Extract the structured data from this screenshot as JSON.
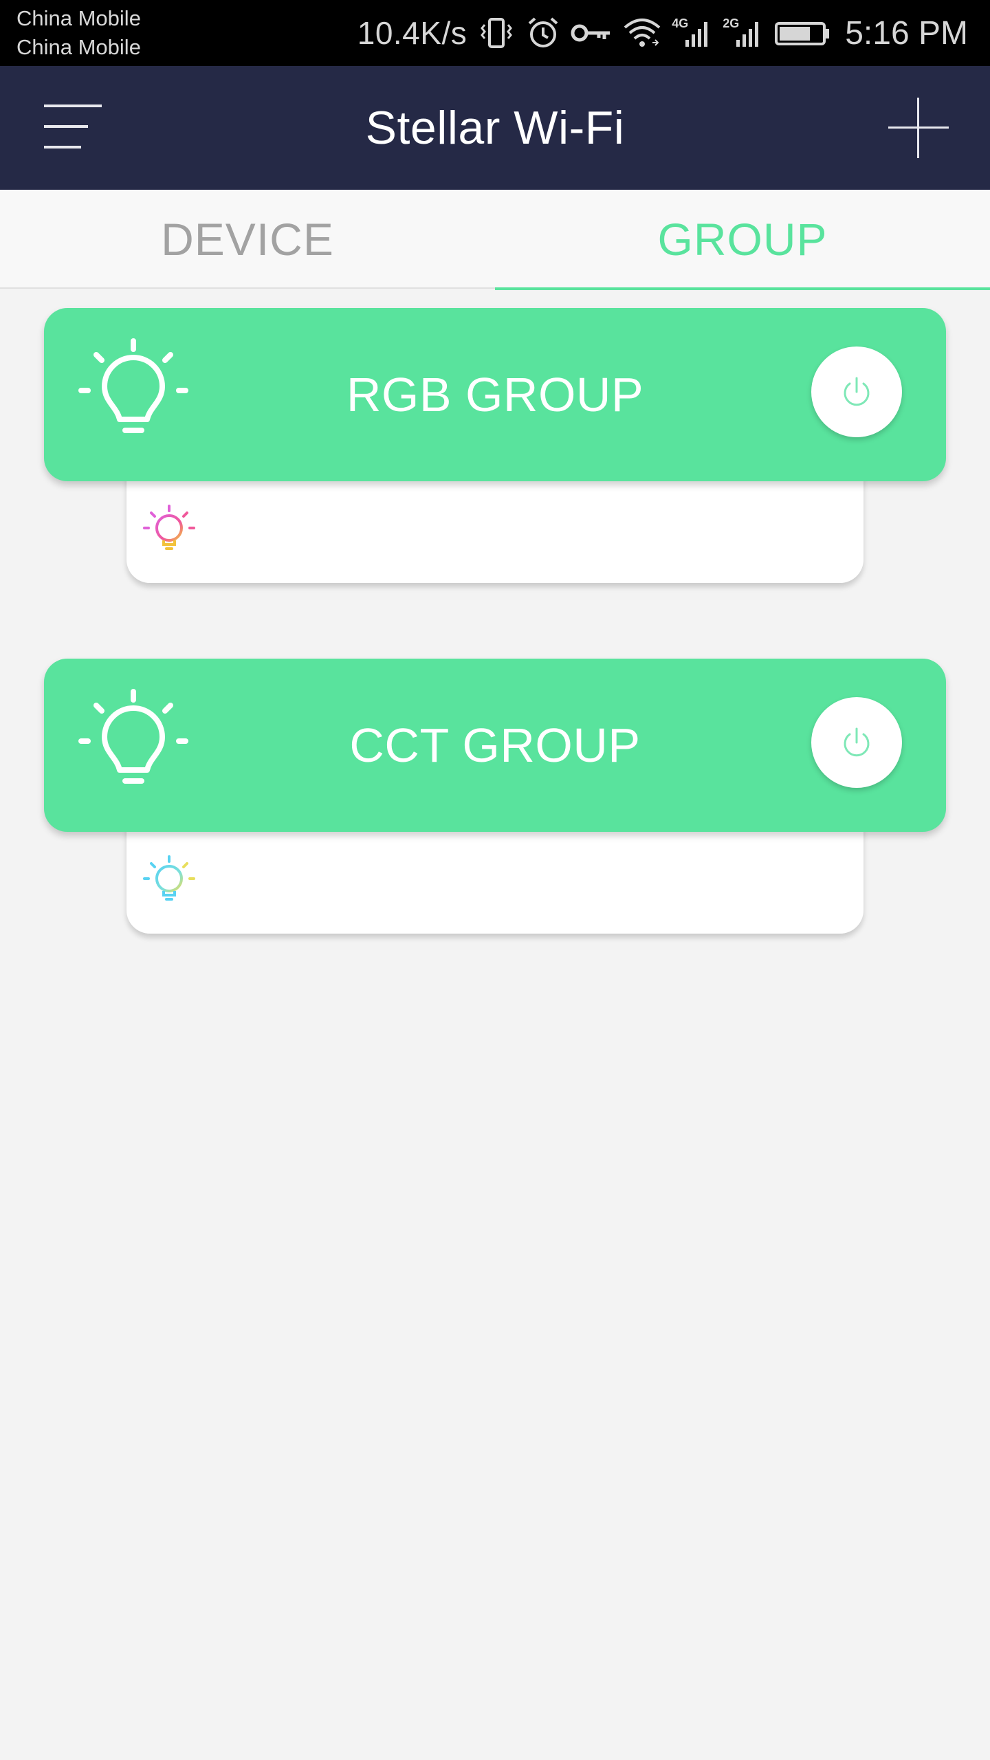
{
  "status_bar": {
    "carrier_1": "China Mobile",
    "carrier_2": "China Mobile",
    "net_speed": "10.4K/s",
    "net_4g": "4G",
    "net_2g": "2G",
    "time": "5:16 PM",
    "icons": [
      "vibrate-icon",
      "alarm-icon",
      "vpn-key-icon",
      "wifi-icon",
      "signal-4g-icon",
      "signal-2g-icon",
      "battery-icon"
    ]
  },
  "app_bar": {
    "title": "Stellar Wi-Fi",
    "left_icon": "menu-icon",
    "right_icon": "add-icon"
  },
  "tabs": [
    {
      "label": "DEVICE",
      "active": false
    },
    {
      "label": "GROUP",
      "active": true
    }
  ],
  "groups": [
    {
      "name": "RGB GROUP",
      "icon": "bulb-icon",
      "sub_icon": "rgb-bulb-icon"
    },
    {
      "name": "CCT GROUP",
      "icon": "bulb-icon",
      "sub_icon": "cct-bulb-icon"
    }
  ],
  "colors": {
    "accent": "#59e39d",
    "app_bar": "#252946",
    "background": "#f3f3f3",
    "tab_inactive": "#a2a2a2"
  }
}
